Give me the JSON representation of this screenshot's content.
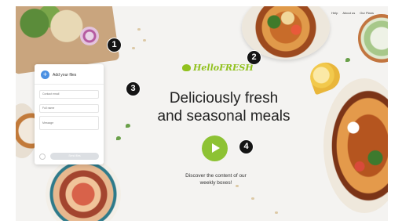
{
  "nav": {
    "items": [
      "Help",
      "About us",
      "Our Plans"
    ]
  },
  "card": {
    "title": "Add your files",
    "fields": [
      {
        "placeholder": "Contact email"
      },
      {
        "placeholder": "Full name"
      },
      {
        "placeholder": "Message"
      }
    ],
    "send_label": "Send files"
  },
  "brand": {
    "logo_text": "HelloFRESH"
  },
  "hero": {
    "headline_line1": "Deliciously fresh",
    "headline_line2": "and seasonal meals",
    "caption_line1": "Discover the content of our",
    "caption_line2": "weekly boxes!"
  },
  "callouts": [
    "1",
    "2",
    "3",
    "4"
  ],
  "colors": {
    "brand_green": "#91c11e",
    "play_green": "#8dc234",
    "callout": "#151515",
    "card_plus": "#4a90e2"
  },
  "icons": {
    "play": "play-icon",
    "plus": "plus-icon",
    "logo": "leaf-logo-icon"
  }
}
